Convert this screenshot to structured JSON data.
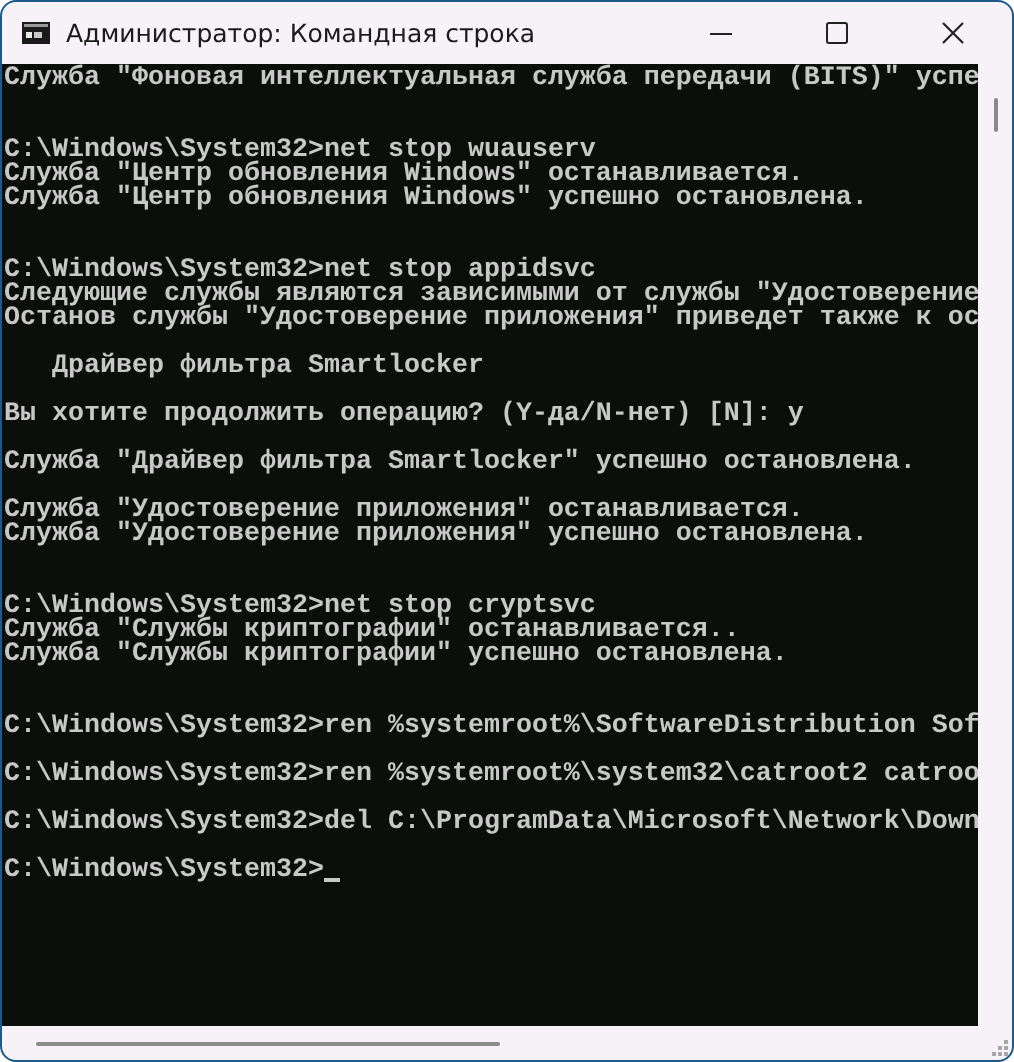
{
  "window": {
    "title": "Администратор: Командная строка"
  },
  "console": {
    "lines": [
      {
        "kind": "text",
        "text": "Служба \"Фоновая интеллектуальная служба передачи (BITS)\" успе"
      },
      {
        "kind": "blank"
      },
      {
        "kind": "blank"
      },
      {
        "kind": "text",
        "text": "C:\\Windows\\System32>net stop wuauserv"
      },
      {
        "kind": "text",
        "text": "Служба \"Центр обновления Windows\" останавливается."
      },
      {
        "kind": "text",
        "text": "Служба \"Центр обновления Windows\" успешно остановлена."
      },
      {
        "kind": "blank"
      },
      {
        "kind": "blank"
      },
      {
        "kind": "text",
        "text": "C:\\Windows\\System32>net stop appidsvc"
      },
      {
        "kind": "text",
        "text": "Следующие службы являются зависимыми от службы \"Удостоверение"
      },
      {
        "kind": "text",
        "text": "Останов службы \"Удостоверение приложения\" приведет также к ос"
      },
      {
        "kind": "blank"
      },
      {
        "kind": "text",
        "text": "   Драйвер фильтра Smartlocker"
      },
      {
        "kind": "blank"
      },
      {
        "kind": "text",
        "text": "Вы хотите продолжить операцию? (Y-да/N-нет) [N]: y"
      },
      {
        "kind": "blank"
      },
      {
        "kind": "text",
        "text": "Служба \"Драйвер фильтра Smartlocker\" успешно остановлена."
      },
      {
        "kind": "blank"
      },
      {
        "kind": "text",
        "text": "Служба \"Удостоверение приложения\" останавливается."
      },
      {
        "kind": "text",
        "text": "Служба \"Удостоверение приложения\" успешно остановлена."
      },
      {
        "kind": "blank"
      },
      {
        "kind": "blank"
      },
      {
        "kind": "text",
        "text": "C:\\Windows\\System32>net stop cryptsvc"
      },
      {
        "kind": "text",
        "text": "Служба \"Службы криптографии\" останавливается.."
      },
      {
        "kind": "text",
        "text": "Служба \"Службы криптографии\" успешно остановлена."
      },
      {
        "kind": "blank"
      },
      {
        "kind": "blank"
      },
      {
        "kind": "text",
        "text": "C:\\Windows\\System32>ren %systemroot%\\SoftwareDistribution Sof"
      },
      {
        "kind": "blank"
      },
      {
        "kind": "text",
        "text": "C:\\Windows\\System32>ren %systemroot%\\system32\\catroot2 catroo"
      },
      {
        "kind": "blank"
      },
      {
        "kind": "text",
        "text": "C:\\Windows\\System32>del C:\\ProgramData\\Microsoft\\Network\\Down"
      },
      {
        "kind": "blank"
      },
      {
        "kind": "text",
        "text": "C:\\Windows\\System32>",
        "cursor": true
      }
    ]
  }
}
